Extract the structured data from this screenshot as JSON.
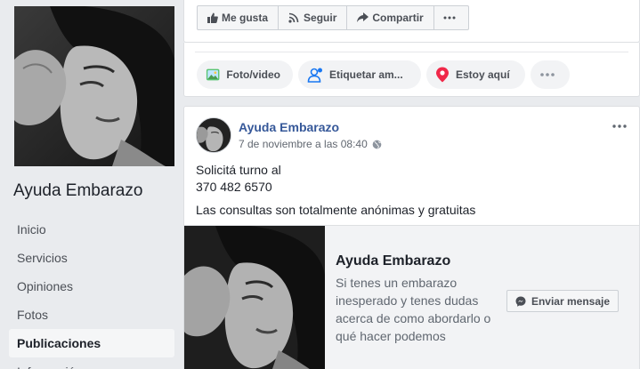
{
  "page": {
    "name": "Ayuda Embarazo"
  },
  "nav": {
    "items": [
      "Inicio",
      "Servicios",
      "Opiniones",
      "Fotos",
      "Publicaciones",
      "Información"
    ],
    "active": "Publicaciones"
  },
  "actions": {
    "like": "Me gusta",
    "follow": "Seguir",
    "share": "Compartir",
    "more_icon": "ellipsis-icon"
  },
  "composer": {
    "photo": "Foto/video",
    "tag": "Etiquetar am...",
    "place": "Estoy aquí"
  },
  "post": {
    "author": "Ayuda Embarazo",
    "time": "7 de noviembre a las 08:40",
    "privacy_icon": "globe-icon",
    "text_line1": "Solicitá turno al",
    "text_line2": "370 482 6570",
    "text_line3": "Las consultas son totalmente anónimas y gratuitas"
  },
  "attachment": {
    "title": "Ayuda Embarazo",
    "description": "Si tenes un embarazo inesperado y tenes dudas acerca de como abordarlo o qué hacer podemos",
    "button": "Enviar mensaje"
  },
  "colors": {
    "link": "#365899",
    "background": "#e9ebee",
    "card": "#ffffff"
  }
}
